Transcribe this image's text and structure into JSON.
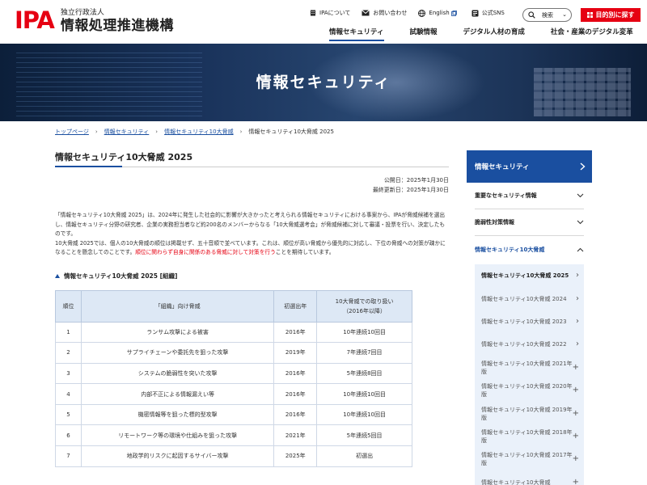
{
  "header": {
    "logo_mark": "IPA",
    "logo_sub": "独立行政法人",
    "logo_main": "情報処理推進機構",
    "util": [
      {
        "icon": "building-icon",
        "label": "IPAについて"
      },
      {
        "icon": "mail-icon",
        "label": "お問い合わせ"
      },
      {
        "icon": "globe-icon",
        "label": "English"
      },
      {
        "icon": "sns-icon",
        "label": "公式SNS"
      }
    ],
    "search_label": "検索",
    "purpose_label": "目的別に探す",
    "nav": [
      "情報セキュリティ",
      "試験情報",
      "デジタル人材の育成",
      "社会・産業のデジタル変革"
    ]
  },
  "hero": {
    "title": "情報セキュリティ"
  },
  "breadcrumb": {
    "items": [
      "トップページ",
      "情報セキュリティ",
      "情報セキュリティ10大脅威"
    ],
    "current": "情報セキュリティ10大脅威 2025"
  },
  "main": {
    "title": "情報セキュリティ10大脅威 2025",
    "published": "公開日：2025年1月30日",
    "updated": "最終更新日：2025年1月30日",
    "lead1": "「情報セキュリティ10大脅威 2025」は、2024年に発生した社会的に影響が大きかったと考えられる情報セキュリティにおける事案から、IPAが脅威候補を選出し、情報セキュリティ分野の研究者、企業の実務担当者など約200名のメンバーからなる「10大脅威選考会」が脅威候補に対して審議・投票を行い、決定したものです。",
    "lead2a": "10大脅威 2025では、個人の10大脅威の順位は掲載せず、五十音順で並べています。これは、順位が高い脅威から優先的に対応し、下位の脅威への対策が疎かになることを懸念してのことです。",
    "lead2_red": "順位に関わらず自身に関係のある脅威に対して対策を行う",
    "lead2b": "ことを期待しています。",
    "section_title": "情報セキュリティ10大脅威 2025 [組織]",
    "table": {
      "headers": [
        "順位",
        "「組織」向け脅威",
        "初選出年",
        "10大脅威での取り扱い",
        "（2016年以降）"
      ],
      "rows": [
        [
          "1",
          "ランサム攻撃による被害",
          "2016年",
          "10年連続10回目"
        ],
        [
          "2",
          "サプライチェーンや委託先を狙った攻撃",
          "2019年",
          "7年連続7回目"
        ],
        [
          "3",
          "システムの脆弱性を突いた攻撃",
          "2016年",
          "5年連続8回目"
        ],
        [
          "4",
          "内部不正による情報漏えい等",
          "2016年",
          "10年連続10回目"
        ],
        [
          "5",
          "機密情報等を狙った標的型攻撃",
          "2016年",
          "10年連続10回目"
        ],
        [
          "6",
          "リモートワーク等の環境や仕組みを狙った攻撃",
          "2021年",
          "5年連続5回目"
        ],
        [
          "7",
          "地政学的リスクに起因するサイバー攻撃",
          "2025年",
          "初選出"
        ]
      ]
    }
  },
  "sidebar": {
    "head": "情報セキュリティ",
    "items": [
      "重要なセキュリティ情報",
      "脆弱性対策情報",
      "情報セキュリティ10大脅威"
    ],
    "sub": [
      {
        "label": "情報セキュリティ10大脅威 2025",
        "mark": "›",
        "current": true
      },
      {
        "label": "情報セキュリティ10大脅威 2024",
        "mark": "›"
      },
      {
        "label": "情報セキュリティ10大脅威 2023",
        "mark": "›"
      },
      {
        "label": "情報セキュリティ10大脅威 2022",
        "mark": "›"
      },
      {
        "label": "情報セキュリティ10大脅威 2021年版",
        "mark": "+"
      },
      {
        "label": "情報セキュリティ10大脅威 2020年版",
        "mark": "+"
      },
      {
        "label": "情報セキュリティ10大脅威 2019年版",
        "mark": "+"
      },
      {
        "label": "情報セキュリティ10大脅威 2018年版",
        "mark": "+"
      },
      {
        "label": "情報セキュリティ10大脅威 2017年版",
        "mark": "+"
      },
      {
        "label": "情報セキュリティ10大脅威",
        "mark": "+"
      }
    ]
  },
  "colors": {
    "brand_red": "#e60012",
    "brand_blue": "#1a4fa0",
    "table_head": "#dde8f5",
    "side_sub_bg": "#eaf1fa"
  }
}
